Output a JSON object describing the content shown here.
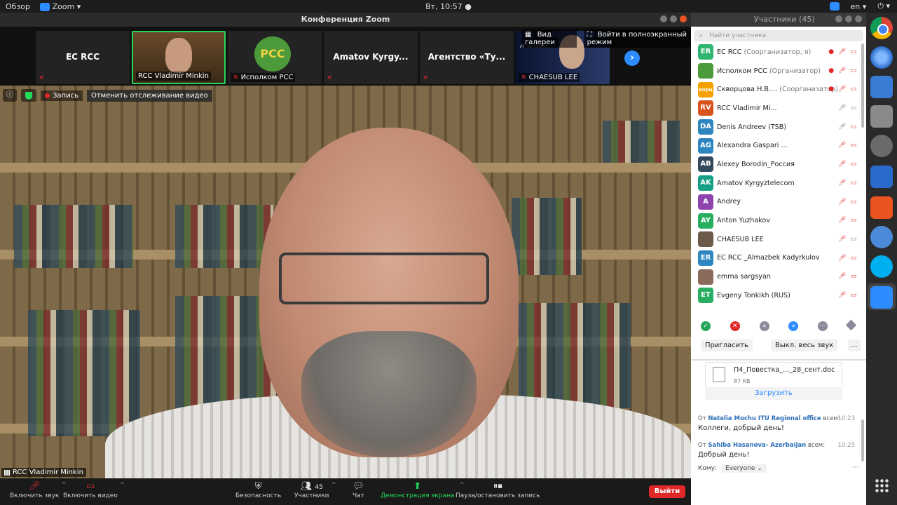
{
  "topbar": {
    "activities": "Обзор",
    "app_name": "Zoom ▾",
    "clock": "Вт, 10:57 ●",
    "lang": "en ▾",
    "power": "⏻ ▾"
  },
  "zoom": {
    "window_title": "Конференция Zoom",
    "thumbnails": [
      {
        "name": "EC RCC",
        "label": ""
      },
      {
        "name": "",
        "label": "RCC Vladimir Minkin"
      },
      {
        "name": "",
        "label": "Исполком РСС",
        "logo": "PCC"
      },
      {
        "name": "Amatov Kyrgy...",
        "label": ""
      },
      {
        "name": "Агентство «Ту...",
        "label": ""
      },
      {
        "name": "",
        "label": "CHAESUB LEE",
        "logo": "AI for Good"
      }
    ],
    "gallery_view": "Вид галереи",
    "fullscreen": "Войти в полноэкранный режим",
    "recording": "Запись",
    "stop_tracking": "Отменить отслеживание видео",
    "speaker_name": "RCC Vladimir Minkin",
    "toolbar": {
      "unmute": "Включить звук",
      "start_video": "Включить видео",
      "security": "Безопасность",
      "participants": "Участники",
      "participants_count": "45",
      "chat": "Чат",
      "share": "Демонстрация экрана",
      "pause_record": "Пауза/остановить запись",
      "leave": "Выйти"
    }
  },
  "panel": {
    "title": "Участники (45)",
    "search_placeholder": "Найти участника",
    "participants": [
      {
        "initials": "ER",
        "name": "EC RCC",
        "role": "(Соорганизатор, я)",
        "color": "#2fb56f"
      },
      {
        "initials": "",
        "name": "Исполком РСС",
        "role": "(Организатор)",
        "color": "#4c9a3a"
      },
      {
        "initials": "ворц",
        "name": "Скворцова Н.В....",
        "role": "(Соорганизатор)",
        "color": "#f4a000"
      },
      {
        "initials": "RV",
        "name": "RCC Vladimir Mi...",
        "role": "",
        "color": "#d9531e"
      },
      {
        "initials": "DA",
        "name": "Denis Andreev (TSB)",
        "role": "",
        "color": "#2e86c1"
      },
      {
        "initials": "AG",
        "name": "Alexandra Gaspari ...",
        "role": "",
        "color": "#2e86c1"
      },
      {
        "initials": "AB",
        "name": "Alexey Borodin_Россия",
        "role": "",
        "color": "#34495e"
      },
      {
        "initials": "AK",
        "name": "Amatov Kyrgyztelecom",
        "role": "",
        "color": "#16a085"
      },
      {
        "initials": "A",
        "name": "Andrey",
        "role": "",
        "color": "#8e44ad"
      },
      {
        "initials": "AY",
        "name": "Anton Yuzhakov",
        "role": "",
        "color": "#27ae60"
      },
      {
        "initials": "",
        "name": "CHAESUB LEE",
        "role": "",
        "color": "#6b5a4a"
      },
      {
        "initials": "ER",
        "name": "EC RCC _Almazbek Kadyrkulov",
        "role": "",
        "color": "#2e86c1"
      },
      {
        "initials": "",
        "name": "emma sargsyan",
        "role": "",
        "color": "#8a6a5a"
      },
      {
        "initials": "ET",
        "name": "Evgeny Tonkikh (RUS)",
        "role": "",
        "color": "#27ae60"
      }
    ],
    "invite": "Пригласить",
    "mute_all": "Выкл. весь звук",
    "more": "...",
    "file": {
      "name": "П4_Повестка_..._28_сент.doc",
      "size": "87 KB",
      "download": "Загрузить"
    },
    "messages": [
      {
        "from_prefix": "От",
        "sender": "Natalia Mochu ITU Regional office",
        "to": "всем:",
        "time": "10:23",
        "text": "Коллеги, добрый день!"
      },
      {
        "from_prefix": "От",
        "sender": "Sahiba Hasanova- Azerbaijan",
        "to": "всем:",
        "time": "10:25",
        "text": "Добрый день!"
      }
    ],
    "to_label": "Кому:",
    "to_value": "Everyone ⌄"
  },
  "colors": {
    "zoom_blue": "#2d8cff",
    "active_green": "#23d959",
    "leave_red": "#e02828"
  }
}
